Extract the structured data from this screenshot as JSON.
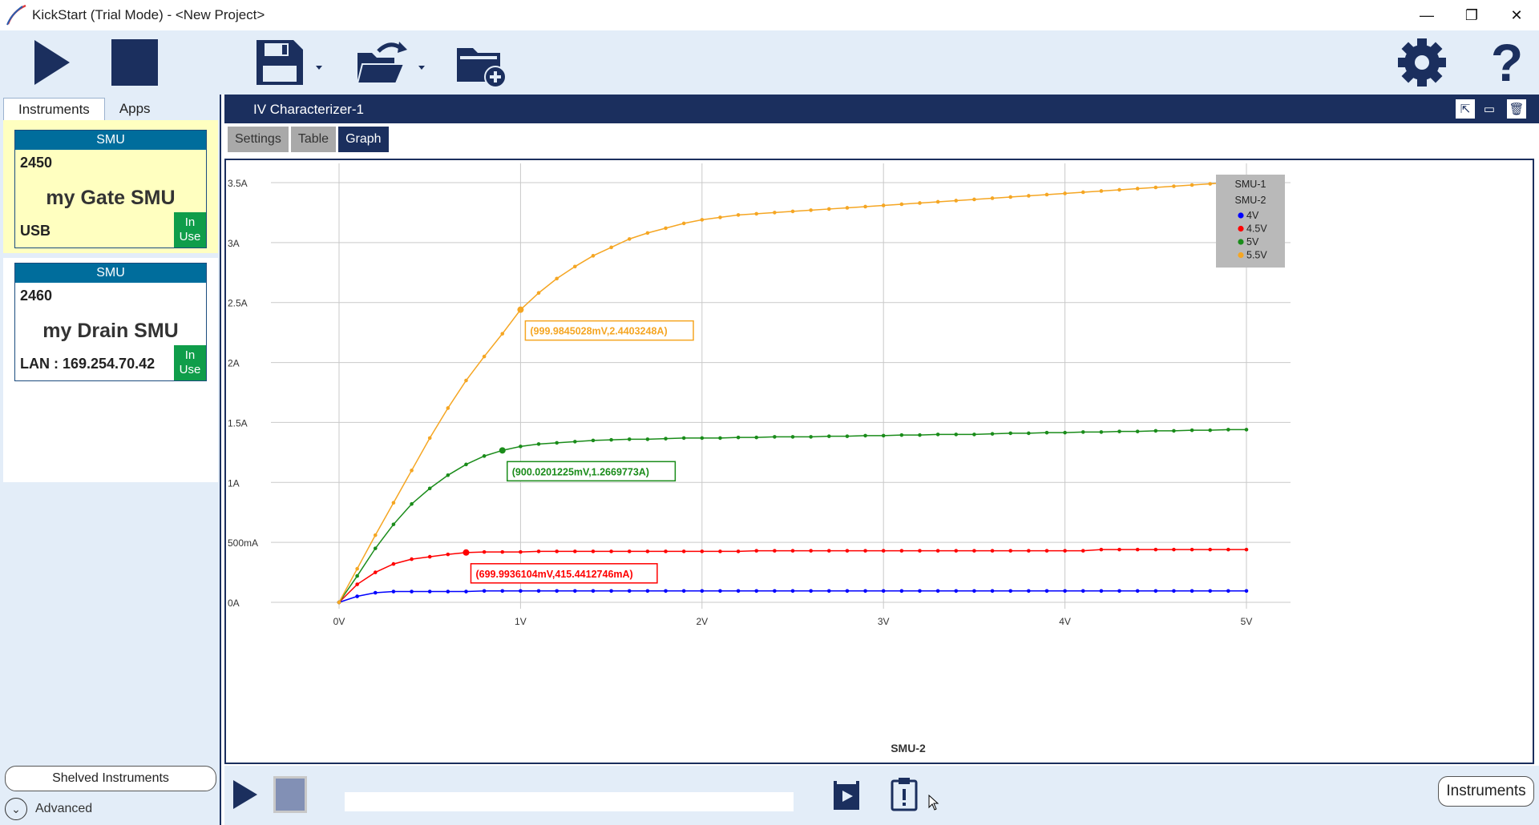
{
  "window": {
    "title": "KickStart (Trial Mode) - <New Project>"
  },
  "toolbar": {
    "run_icon": "play-icon",
    "stop_icon": "stop-icon",
    "save_icon": "save-icon",
    "open_icon": "open-folder-icon",
    "new_icon": "new-folder-icon",
    "settings_icon": "gear-icon",
    "help_icon": "help-icon"
  },
  "sidebar": {
    "tabs": [
      {
        "label": "Instruments",
        "active": true
      },
      {
        "label": "Apps",
        "active": false
      }
    ],
    "instruments": [
      {
        "type": "SMU",
        "model": "2450",
        "name": "my Gate SMU",
        "connection": "USB",
        "status": "In Use",
        "selected": true
      },
      {
        "type": "SMU",
        "model": "2460",
        "name": "my Drain SMU",
        "connection": "LAN : 169.254.70.42",
        "status": "In Use",
        "selected": false
      }
    ],
    "shelved_label": "Shelved Instruments",
    "advanced_label": "Advanced"
  },
  "panel": {
    "title": "IV Characterizer-1",
    "tabs": [
      {
        "label": "Settings",
        "active": false
      },
      {
        "label": "Table",
        "active": false
      },
      {
        "label": "Graph",
        "active": true
      }
    ]
  },
  "bottom": {
    "instruments_label": "Instruments",
    "progress": 0
  },
  "colors": {
    "navy": "#1b2f5e",
    "toolbar_bg": "#e3edf8",
    "in_use": "#0f9d4a",
    "card_head": "#006d9c",
    "selected_card": "#ffffc0"
  },
  "chart_data": {
    "type": "line",
    "xlabel": "SMU-2",
    "ylabel": "",
    "xlim": [
      0,
      5
    ],
    "ylim": [
      0,
      3.5
    ],
    "x_ticks": [
      {
        "v": 0,
        "label": "0V"
      },
      {
        "v": 1,
        "label": "1V"
      },
      {
        "v": 2,
        "label": "2V"
      },
      {
        "v": 3,
        "label": "3V"
      },
      {
        "v": 4,
        "label": "4V"
      },
      {
        "v": 5,
        "label": "5V"
      }
    ],
    "y_ticks": [
      {
        "v": 0,
        "label": "0A"
      },
      {
        "v": 0.5,
        "label": "500mA"
      },
      {
        "v": 1,
        "label": "1A"
      },
      {
        "v": 1.5,
        "label": "1.5A"
      },
      {
        "v": 2,
        "label": "2A"
      },
      {
        "v": 2.5,
        "label": "2.5A"
      },
      {
        "v": 3,
        "label": "3A"
      },
      {
        "v": 3.5,
        "label": "3.5A"
      }
    ],
    "grid": true,
    "legend": {
      "placement": "top-right",
      "headers": [
        "SMU-1",
        "SMU-2"
      ]
    },
    "x": [
      0,
      0.1,
      0.2,
      0.3,
      0.4,
      0.5,
      0.6,
      0.7,
      0.8,
      0.9,
      1.0,
      1.1,
      1.2,
      1.3,
      1.4,
      1.5,
      1.6,
      1.7,
      1.8,
      1.9,
      2.0,
      2.1,
      2.2,
      2.3,
      2.4,
      2.5,
      2.6,
      2.7,
      2.8,
      2.9,
      3.0,
      3.1,
      3.2,
      3.3,
      3.4,
      3.5,
      3.6,
      3.7,
      3.8,
      3.9,
      4.0,
      4.1,
      4.2,
      4.3,
      4.4,
      4.5,
      4.6,
      4.7,
      4.8,
      4.9,
      5.0
    ],
    "series": [
      {
        "name": "4V",
        "color": "#0000ff",
        "values": [
          0,
          0.05,
          0.08,
          0.09,
          0.09,
          0.09,
          0.09,
          0.09,
          0.095,
          0.095,
          0.095,
          0.095,
          0.095,
          0.095,
          0.095,
          0.095,
          0.095,
          0.095,
          0.095,
          0.095,
          0.095,
          0.095,
          0.095,
          0.095,
          0.095,
          0.095,
          0.095,
          0.095,
          0.095,
          0.095,
          0.095,
          0.095,
          0.095,
          0.095,
          0.095,
          0.095,
          0.095,
          0.095,
          0.095,
          0.095,
          0.095,
          0.095,
          0.095,
          0.095,
          0.095,
          0.095,
          0.095,
          0.095,
          0.095,
          0.095,
          0.095
        ]
      },
      {
        "name": "4.5V",
        "color": "#ff0000",
        "values": [
          0,
          0.15,
          0.25,
          0.32,
          0.36,
          0.38,
          0.4,
          0.415,
          0.42,
          0.42,
          0.42,
          0.425,
          0.425,
          0.425,
          0.425,
          0.425,
          0.425,
          0.425,
          0.425,
          0.425,
          0.425,
          0.425,
          0.425,
          0.43,
          0.43,
          0.43,
          0.43,
          0.43,
          0.43,
          0.43,
          0.43,
          0.43,
          0.43,
          0.43,
          0.43,
          0.43,
          0.43,
          0.43,
          0.43,
          0.43,
          0.43,
          0.43,
          0.44,
          0.44,
          0.44,
          0.44,
          0.44,
          0.44,
          0.44,
          0.44,
          0.44
        ]
      },
      {
        "name": "5V",
        "color": "#1a8c1a",
        "values": [
          0,
          0.22,
          0.45,
          0.65,
          0.82,
          0.95,
          1.06,
          1.15,
          1.22,
          1.2669773,
          1.3,
          1.32,
          1.33,
          1.34,
          1.35,
          1.355,
          1.36,
          1.36,
          1.365,
          1.37,
          1.37,
          1.37,
          1.375,
          1.375,
          1.38,
          1.38,
          1.38,
          1.385,
          1.385,
          1.39,
          1.39,
          1.395,
          1.395,
          1.4,
          1.4,
          1.4,
          1.405,
          1.41,
          1.41,
          1.415,
          1.415,
          1.42,
          1.42,
          1.425,
          1.425,
          1.43,
          1.43,
          1.435,
          1.435,
          1.44,
          1.44
        ]
      },
      {
        "name": "5.5V",
        "color": "#f5a623",
        "values": [
          0,
          0.28,
          0.56,
          0.83,
          1.1,
          1.37,
          1.62,
          1.85,
          2.05,
          2.24,
          2.4403248,
          2.58,
          2.7,
          2.8,
          2.89,
          2.96,
          3.03,
          3.08,
          3.12,
          3.16,
          3.19,
          3.21,
          3.23,
          3.24,
          3.25,
          3.26,
          3.27,
          3.28,
          3.29,
          3.3,
          3.31,
          3.32,
          3.33,
          3.34,
          3.35,
          3.36,
          3.37,
          3.38,
          3.39,
          3.4,
          3.41,
          3.42,
          3.43,
          3.44,
          3.45,
          3.46,
          3.47,
          3.48,
          3.49,
          3.5,
          3.5
        ]
      }
    ],
    "annotations": [
      {
        "series": "5.5V",
        "x": 0.9999845028,
        "y": 2.4403248,
        "label": "(999.9845028mV,2.4403248A)",
        "color": "#f5a623"
      },
      {
        "series": "5V",
        "x": 0.9000201225,
        "y": 1.2669773,
        "label": "(900.0201225mV,1.2669773A)",
        "color": "#1a8c1a"
      },
      {
        "series": "4.5V",
        "x": 0.6999936104,
        "y": 0.4154412746,
        "label": "(699.9936104mV,415.4412746mA)",
        "color": "#ff0000"
      }
    ]
  }
}
